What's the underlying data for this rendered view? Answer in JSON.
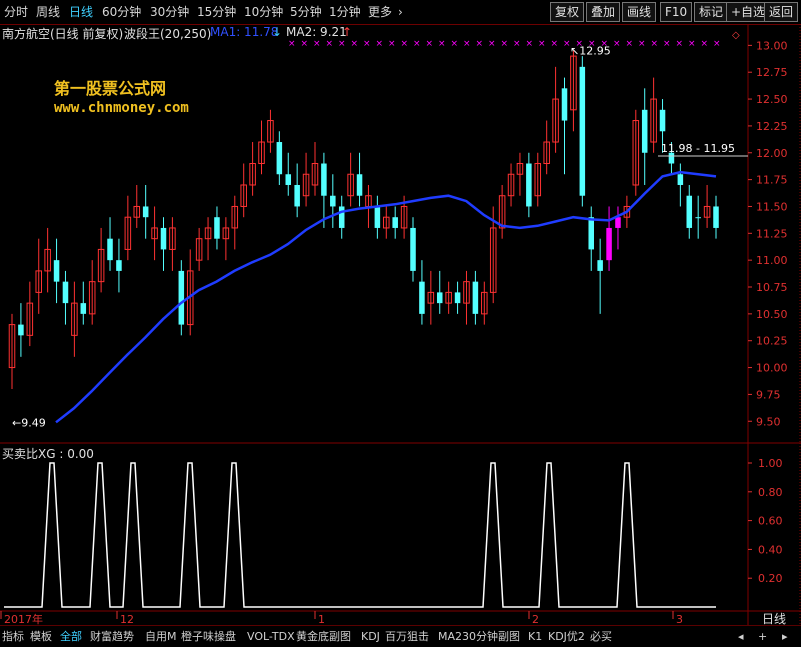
{
  "toolbar": {
    "tabs": [
      "分时",
      "周线",
      "日线",
      "60分钟",
      "30分钟",
      "15分钟",
      "10分钟",
      "5分钟",
      "1分钟",
      "更多"
    ],
    "active_tab": "日线",
    "more_arrow": "›",
    "right_buttons": [
      "复权",
      "叠加",
      "画线",
      "F10",
      "标记",
      "+自选",
      "返回"
    ]
  },
  "info": {
    "stock": "南方航空(日线 前复权)",
    "indicator": "波段王(20,250)",
    "ma1": "MA1: 11.78",
    "ma1_arrow": "↓",
    "ma2": "MA2: 9.21",
    "ma2_arrow": "↑"
  },
  "watermark": {
    "line1": "第一股票公式网",
    "line2": "www.chnmoney.com"
  },
  "annotations": {
    "high": "12.95",
    "low": "9.49",
    "range": "11.98 - 11.95"
  },
  "main_axis": {
    "ticks": [
      "13.00",
      "12.75",
      "12.50",
      "12.25",
      "12.00",
      "11.75",
      "11.50",
      "11.25",
      "11.00",
      "10.75",
      "10.50",
      "10.25",
      "10.00",
      "9.75",
      "9.50"
    ]
  },
  "sub_panel": {
    "label": "买卖比XG : 0.00",
    "ticks": [
      "1.00",
      "0.80",
      "0.60",
      "0.40",
      "0.20"
    ]
  },
  "time_axis": {
    "labels": [
      "2017年",
      "12",
      "1",
      "2",
      "3"
    ],
    "period": "日线"
  },
  "colors": {
    "up": "#ff3232",
    "down": "#54ffff",
    "ma": "#1f3cff",
    "grid": "#800000",
    "pink": "#ff00ff"
  },
  "bottom": {
    "items": [
      "指标",
      "模板",
      "全部",
      "财富趋势",
      "自用M",
      "橙子味操盘",
      "VOL-TDX",
      "黄金底副图",
      "KDJ",
      "百万狙击",
      "MA2",
      "30分钟副图",
      "K1",
      "KDJ优2",
      "必买"
    ],
    "active": "全部",
    "nav": [
      "◂",
      "+",
      "▸"
    ]
  },
  "chart_data": [
    {
      "type": "line",
      "title": "南方航空(日线 前复权)",
      "series": [
        {
          "name": "MA1",
          "values": [
            9.49,
            9.62,
            9.78,
            9.95,
            10.12,
            10.28,
            10.45,
            10.6,
            10.72,
            10.8,
            10.9,
            10.98,
            11.05,
            11.15,
            11.28,
            11.38,
            11.45,
            11.48,
            11.5,
            11.52,
            11.55,
            11.58,
            11.6,
            11.55,
            11.42,
            11.32,
            11.3,
            11.32,
            11.36,
            11.4,
            11.38,
            11.37,
            11.45,
            11.62,
            11.78,
            11.82,
            11.8,
            11.78
          ]
        }
      ],
      "ylim": [
        9.4,
        13.05
      ],
      "annotations": [
        "12.95",
        "9.49",
        "11.98 - 11.95"
      ]
    },
    {
      "type": "line",
      "title": "买卖比XG",
      "series": [
        {
          "name": "买卖比XG",
          "values": [
            0,
            1,
            0,
            1,
            0,
            1,
            1,
            0,
            1,
            0,
            1,
            0,
            0,
            0,
            0,
            0,
            0,
            0,
            0,
            0,
            0,
            0,
            0,
            0,
            1,
            0,
            0,
            1,
            0,
            0,
            0,
            1,
            0,
            0,
            0,
            0,
            0,
            0
          ]
        }
      ],
      "ylim": [
        0,
        1.0
      ]
    }
  ]
}
